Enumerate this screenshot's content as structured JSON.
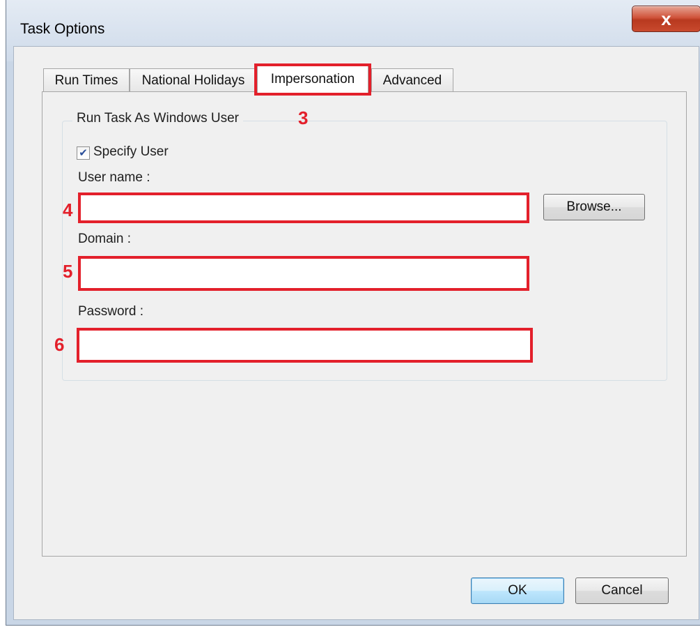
{
  "window": {
    "title": "Task Options",
    "close_glyph": "x"
  },
  "tabs": [
    {
      "label": "Run Times",
      "active": false
    },
    {
      "label": "National Holidays",
      "active": false
    },
    {
      "label": "Impersonation",
      "active": true
    },
    {
      "label": "Advanced",
      "active": false
    }
  ],
  "group": {
    "legend": "Run Task As Windows User",
    "specify_user": {
      "label": "Specify User",
      "checked": true
    },
    "username": {
      "label": "User name :",
      "value": ""
    },
    "browse_label": "Browse...",
    "domain": {
      "label": "Domain :",
      "value": ""
    },
    "password": {
      "label": "Password :",
      "value": ""
    }
  },
  "annotations": {
    "tab": "3",
    "username": "4",
    "domain": "5",
    "password": "6",
    "color": "#e3202b"
  },
  "buttons": {
    "ok": "OK",
    "cancel": "Cancel"
  }
}
